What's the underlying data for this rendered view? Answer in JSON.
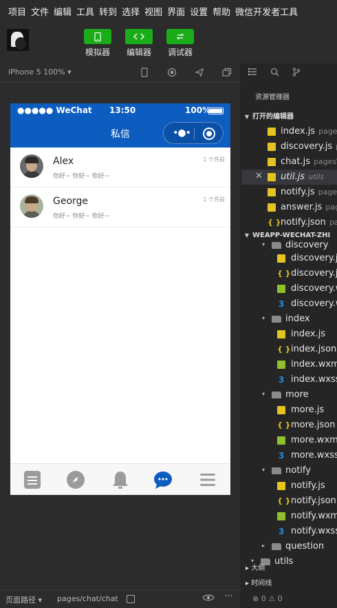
{
  "menu": [
    "项目",
    "文件",
    "编辑",
    "工具",
    "转到",
    "选择",
    "视图",
    "界面",
    "设置",
    "帮助",
    "微信开发者工具"
  ],
  "toolbar": {
    "simulator": {
      "label": "模拟器",
      "icon": "phone-icon"
    },
    "editor": {
      "label": "编辑器",
      "icon": "code-icon"
    },
    "debugger": {
      "label": "调试器",
      "icon": "debug-icon"
    },
    "accent": "#1aad19"
  },
  "simbar": {
    "device": "iPhone 5 100% ▾"
  },
  "phone": {
    "status": {
      "carrier": "●●●●● WeChat",
      "time": "13:50",
      "battery": "100%"
    },
    "nav_title": "私信",
    "nav_color": "#0d5cbf",
    "chats": [
      {
        "name": "Alex",
        "message": "你好~ 你好~ 你好~",
        "time": "1 个月前"
      },
      {
        "name": "George",
        "message": "你好~ 你好~ 你好~",
        "time": "1 个月前"
      }
    ],
    "tabs": [
      {
        "icon": "list-icon",
        "active": false
      },
      {
        "icon": "compass-icon",
        "active": false
      },
      {
        "icon": "bell-icon",
        "active": false
      },
      {
        "icon": "chat-bubble-icon",
        "active": true
      },
      {
        "icon": "menu-icon",
        "active": false
      }
    ]
  },
  "bottombar": {
    "path_label": "页面路径 ▾",
    "path": "pages/chat/chat"
  },
  "explorer": {
    "title": "资源管理器",
    "open_editors_label": "打开的编辑器",
    "open_editors": [
      {
        "name": "index.js",
        "path": "pages",
        "type": "js"
      },
      {
        "name": "discovery.js",
        "path": "p",
        "type": "js"
      },
      {
        "name": "chat.js",
        "path": "pages\\",
        "type": "js"
      },
      {
        "name": "util.js",
        "path": "utils",
        "type": "js",
        "selected": true,
        "italic": true
      },
      {
        "name": "notify.js",
        "path": "page",
        "type": "js"
      },
      {
        "name": "answer.js",
        "path": "pag",
        "type": "js"
      },
      {
        "name": "notify.json",
        "path": "pa",
        "type": "json"
      }
    ],
    "project_label": "WEAPP-WECHAT-ZHI",
    "tree": [
      {
        "name": "discovery",
        "type": "folder-partial",
        "indent": 2
      },
      {
        "name": "discovery.js",
        "type": "js",
        "indent": 3
      },
      {
        "name": "discovery.js",
        "type": "json",
        "indent": 3
      },
      {
        "name": "discovery.w",
        "type": "wxml",
        "indent": 3
      },
      {
        "name": "discovery.w",
        "type": "wxss",
        "indent": 3
      },
      {
        "name": "index",
        "type": "folder",
        "indent": 2
      },
      {
        "name": "index.js",
        "type": "js",
        "indent": 3
      },
      {
        "name": "index.json",
        "type": "json",
        "indent": 3
      },
      {
        "name": "index.wxml",
        "type": "wxml",
        "indent": 3
      },
      {
        "name": "index.wxss",
        "type": "wxss",
        "indent": 3
      },
      {
        "name": "more",
        "type": "folder",
        "indent": 2
      },
      {
        "name": "more.js",
        "type": "js",
        "indent": 3
      },
      {
        "name": "more.json",
        "type": "json",
        "indent": 3
      },
      {
        "name": "more.wxml",
        "type": "wxml",
        "indent": 3
      },
      {
        "name": "more.wxss",
        "type": "wxss",
        "indent": 3
      },
      {
        "name": "notify",
        "type": "folder",
        "indent": 2
      },
      {
        "name": "notify.js",
        "type": "js",
        "indent": 3
      },
      {
        "name": "notify.json",
        "type": "json",
        "indent": 3
      },
      {
        "name": "notify.wxml",
        "type": "wxml",
        "indent": 3
      },
      {
        "name": "notify.wxss",
        "type": "wxss",
        "indent": 3
      },
      {
        "name": "question",
        "type": "folder-collapsed",
        "indent": 2
      },
      {
        "name": "utils",
        "type": "folder-partial",
        "indent": 1
      }
    ],
    "outline_label": "大纲",
    "timeline_label": "时间线",
    "problems": "⊗ 0 ⚠ 0"
  }
}
